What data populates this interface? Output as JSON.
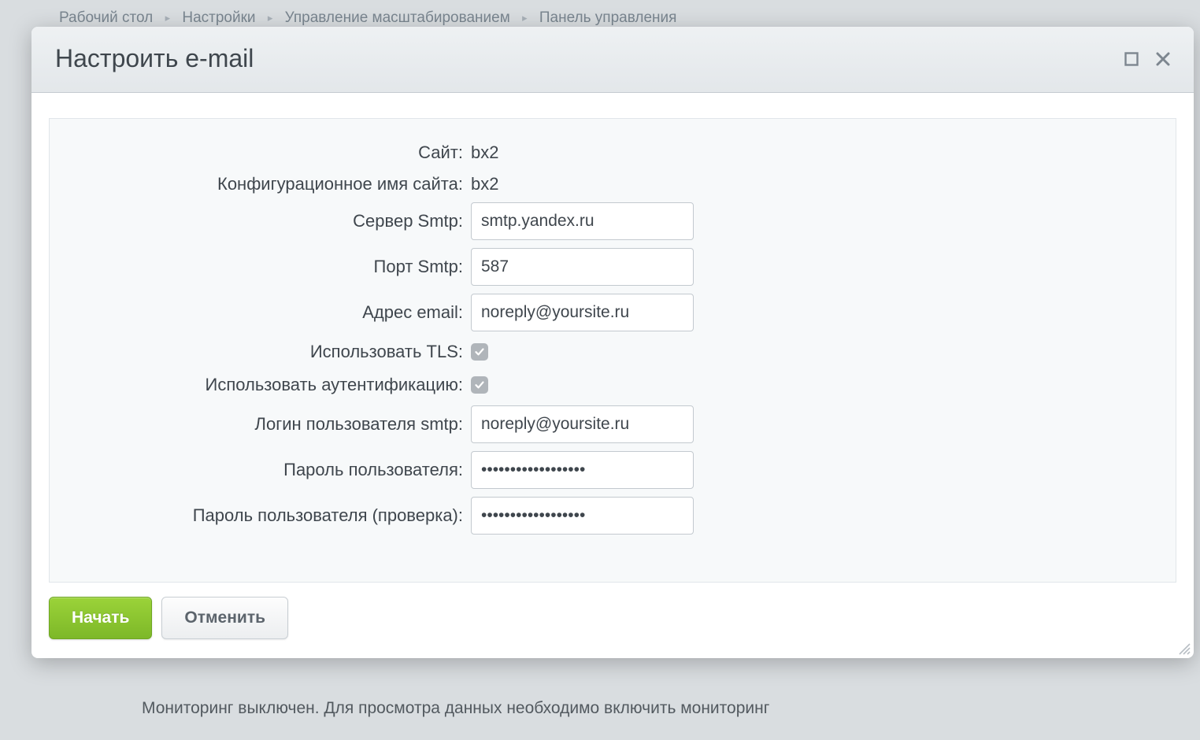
{
  "breadcrumb": {
    "items": [
      "Рабочий стол",
      "Настройки",
      "Управление масштабированием",
      "Панель управления"
    ]
  },
  "background": {
    "monitoring_text": "Мониторинг выключен. Для просмотра данных необходимо включить мониторинг"
  },
  "modal": {
    "title": "Настроить e-mail",
    "form": {
      "site_label": "Сайт:",
      "site_value": "bx2",
      "config_name_label": "Конфигурационное имя сайта:",
      "config_name_value": "bx2",
      "smtp_server_label": "Сервер Smtp:",
      "smtp_server_value": "smtp.yandex.ru",
      "smtp_port_label": "Порт Smtp:",
      "smtp_port_value": "587",
      "email_address_label": "Адрес email:",
      "email_address_value": "noreply@yoursite.ru",
      "use_tls_label": "Использовать TLS:",
      "use_tls_checked": true,
      "use_auth_label": "Использовать аутентификацию:",
      "use_auth_checked": true,
      "smtp_login_label": "Логин пользователя smtp:",
      "smtp_login_value": "noreply@yoursite.ru",
      "password_label": "Пароль пользователя:",
      "password_value": "••••••••••••••••••",
      "password_confirm_label": "Пароль пользователя (проверка):",
      "password_confirm_value": "••••••••••••••••••"
    },
    "footer": {
      "start_label": "Начать",
      "cancel_label": "Отменить"
    }
  }
}
